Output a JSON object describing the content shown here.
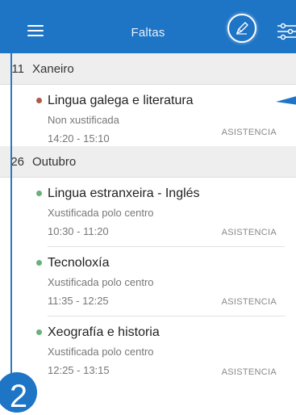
{
  "header": {
    "title": "Faltas",
    "menu_icon": "hamburger-menu-icon",
    "edit_icon": "pencil-edit-icon",
    "filter_icon": "sliders-filter-icon"
  },
  "colors": {
    "header_bg": "#1e74c5",
    "section_bg": "#eeeeef",
    "unjustified_dot": "#b0594a",
    "justified_dot": "#69b07b"
  },
  "sections": [
    {
      "day": "11",
      "month": "Xaneiro",
      "entries": [
        {
          "subject": "Lingua galega e literatura",
          "status": "Non xustificada",
          "time": "14:20 - 15:10",
          "type": "ASISTENCIA",
          "justified": false
        }
      ]
    },
    {
      "day": "26",
      "month": "Outubro",
      "entries": [
        {
          "subject": "Lingua estranxeira - Inglés",
          "status": "Xustificada polo centro",
          "time": "10:30 - 11:20",
          "type": "ASISTENCIA",
          "justified": true
        },
        {
          "subject": "Tecnoloxía",
          "status": "Xustificada polo centro",
          "time": "11:35 - 12:25",
          "type": "ASISTENCIA",
          "justified": true
        },
        {
          "subject": "Xeografía e historia",
          "status": "Xustificada polo centro",
          "time": "12:25 - 13:15",
          "type": "ASISTENCIA",
          "justified": true
        }
      ]
    }
  ],
  "overlay_badge": "2"
}
